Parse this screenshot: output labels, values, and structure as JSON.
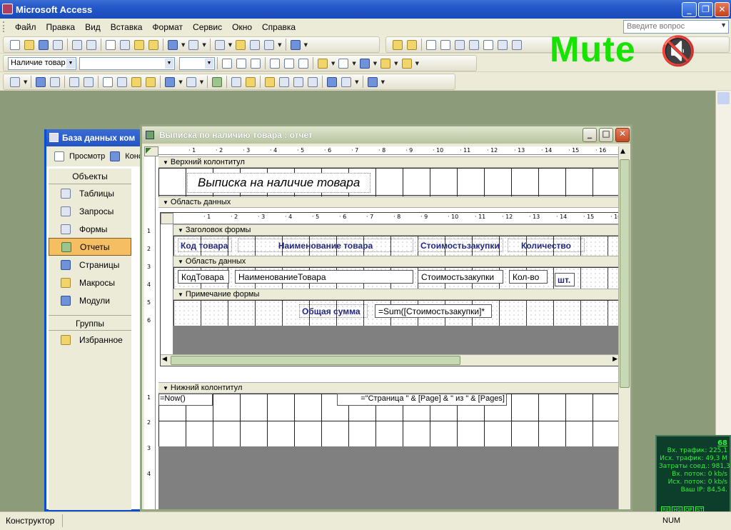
{
  "app": {
    "title": "Microsoft Access"
  },
  "menu": {
    "items": [
      "Файл",
      "Правка",
      "Вид",
      "Вставка",
      "Формат",
      "Сервис",
      "Окно",
      "Справка"
    ]
  },
  "ask": {
    "placeholder": "Введите вопрос"
  },
  "toolbar2": {
    "object_select": "Наличие товар"
  },
  "overlay": {
    "mute_text": "Mute",
    "mute_icon_glyph": "🔇"
  },
  "db_window": {
    "title": "База данных ком",
    "preview_label": "Просмотр",
    "design_label": "Конст",
    "objects_header": "Объекты",
    "objects": [
      "Таблицы",
      "Запросы",
      "Формы",
      "Отчеты",
      "Страницы",
      "Макросы",
      "Модули"
    ],
    "active_object": "Отчеты",
    "groups_header": "Группы",
    "groups": [
      "Избранное"
    ]
  },
  "report_window": {
    "title": "Выписка по наличию товара : отчет",
    "ruler_ticks": [
      "1",
      "2",
      "3",
      "4",
      "5",
      "6",
      "7",
      "8",
      "9",
      "10",
      "11",
      "12",
      "13",
      "14",
      "15",
      "16"
    ],
    "vruler_ticks": [
      "1",
      "2",
      "3",
      "4",
      "5",
      "6",
      "1",
      "2",
      "3",
      "4"
    ],
    "sections": {
      "page_header": "Верхний колонтитул",
      "detail": "Область данных",
      "page_footer": "Нижний колонтитул"
    },
    "report_title": "Выписка на наличие товара",
    "subform": {
      "form_header": "Заголовок формы",
      "detail": "Область данных",
      "form_footer": "Примечание формы",
      "labels": [
        "Код товара",
        "Наименование товара",
        "Стоимостьзакупки",
        "Количество"
      ],
      "fields": [
        "КодТовара",
        "НаименованиеТовара",
        "Стоимостьзакупки",
        "Кол-во"
      ],
      "unit_label": "шт.",
      "total_label": "Общая сумма",
      "total_expr": "=Sum([Стоимостьзакупки]*"
    },
    "footer_now": "=Now()",
    "footer_page": "=\"Страница \" & [Page] & \" из \" & [Pages]"
  },
  "netmon": {
    "big_value": "68",
    "rows": [
      "Вх. трафик: 225,1",
      "Исх. трафик: 49,3 M",
      "Затраты соед.: 981,3",
      "Вх. поток: 0 kb/s",
      "Исх. поток: 0 kb/s",
      "Ваш IP: 84,54."
    ],
    "buttons": [
      "RE",
      "HG",
      "OP",
      "ST"
    ]
  },
  "status": {
    "mode": "Конструктор",
    "num": "NUM"
  }
}
